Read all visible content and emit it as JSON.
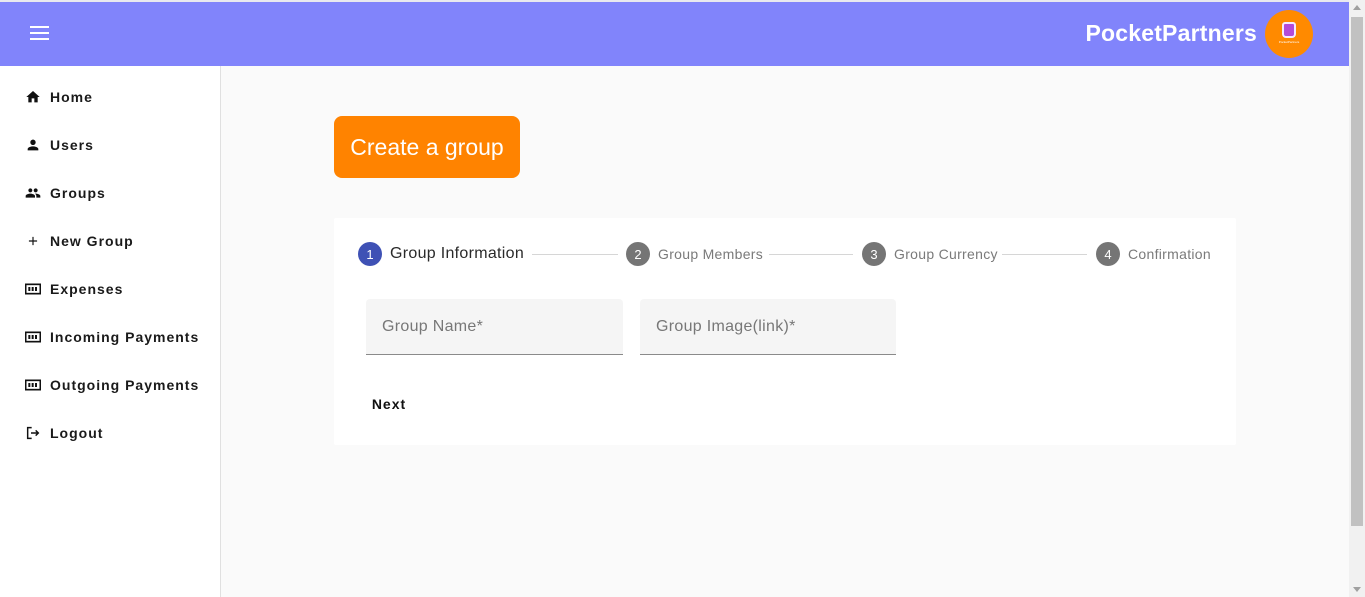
{
  "header": {
    "brand": "PocketPartners",
    "logo_text": "PocketPartners"
  },
  "sidebar": {
    "items": [
      {
        "label": "Home",
        "icon": "home-icon"
      },
      {
        "label": "Users",
        "icon": "person-icon"
      },
      {
        "label": "Groups",
        "icon": "people-icon"
      },
      {
        "label": "New Group",
        "icon": "plus-icon"
      },
      {
        "label": "Expenses",
        "icon": "payments-icon"
      },
      {
        "label": "Incoming Payments",
        "icon": "payments-icon"
      },
      {
        "label": "Outgoing Payments",
        "icon": "payments-icon"
      },
      {
        "label": "Logout",
        "icon": "logout-icon"
      }
    ]
  },
  "main": {
    "title_button": "Create a group"
  },
  "stepper": {
    "steps": [
      {
        "number": "1",
        "label": "Group Information",
        "active": true
      },
      {
        "number": "2",
        "label": "Group Members",
        "active": false
      },
      {
        "number": "3",
        "label": "Group Currency",
        "active": false
      },
      {
        "number": "4",
        "label": "Confirmation",
        "active": false
      }
    ]
  },
  "form": {
    "group_name": {
      "value": "",
      "placeholder": "Group Name*"
    },
    "group_image": {
      "value": "",
      "placeholder": "Group Image(link)*"
    },
    "next_label": "Next"
  },
  "colors": {
    "header": "#8184fb",
    "accent": "#ff8300",
    "step_active": "#3f51b5",
    "step_inactive": "#757575"
  }
}
